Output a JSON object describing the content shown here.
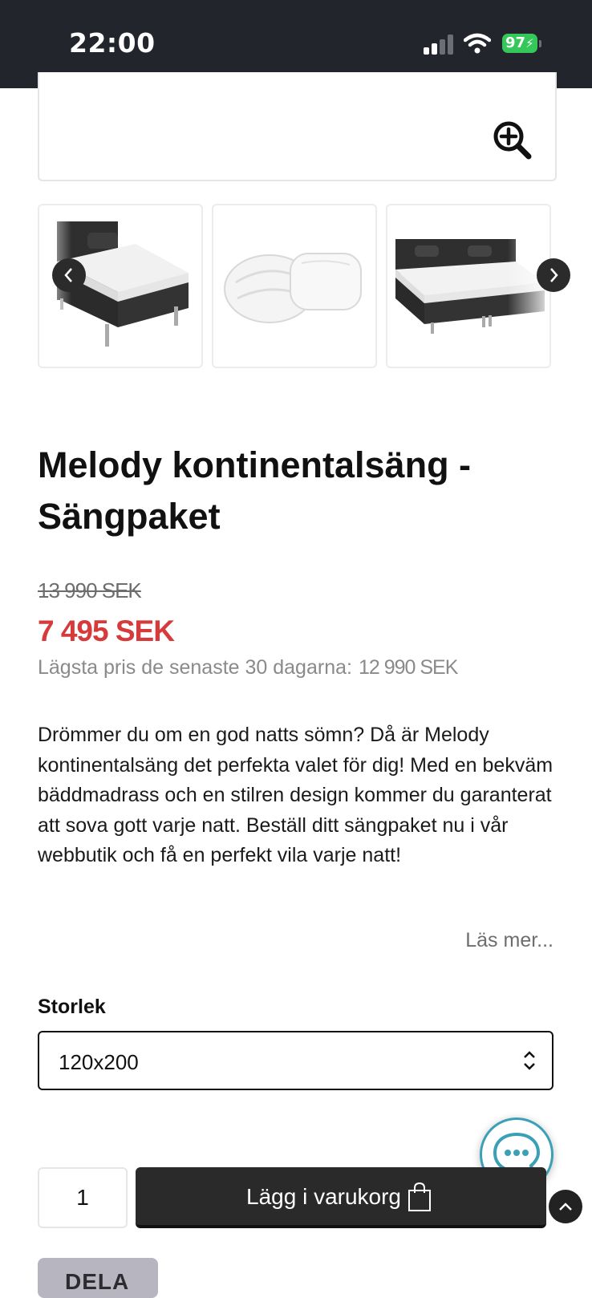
{
  "status_bar": {
    "time": "22:00",
    "battery": "97",
    "icons": [
      "cellular-signal-icon",
      "wifi-icon",
      "battery-charging-icon"
    ]
  },
  "gallery": {
    "zoom_icon": "zoom-in-icon",
    "thumbnails": [
      {
        "alt": "single-bed-image"
      },
      {
        "alt": "duvet-and-pillow-image"
      },
      {
        "alt": "double-bed-image"
      }
    ],
    "prev_icon": "chevron-left-icon",
    "next_icon": "chevron-right-icon"
  },
  "product": {
    "title": "Melody kontinentalsäng - Sängpaket",
    "old_price": "13 990 SEK",
    "price": "7 495 SEK",
    "lowest_price_label": "Lägsta pris de senaste 30 dagarna:",
    "lowest_price_value": "12 990 SEK",
    "description": "Drömmer du om en god natts sömn? Då är Melody kontinentalsäng det perfekta valet för dig! Med en bekväm bäddmadrass och en stilren design kommer du garanterat att sova gott varje natt. Beställ ditt sängpaket nu i vår webbutik och få en perfekt vila varje natt!",
    "read_more": "Läs mer..."
  },
  "options": {
    "size_label": "Storlek",
    "size_value": "120x200"
  },
  "purchase": {
    "quantity": "1",
    "add_to_cart": "Lägg i varukorg",
    "share": "DELA"
  },
  "colors": {
    "status_bar_bg": "#23252c",
    "sale_price": "#d63a3a",
    "button_dark": "#2a2a2a",
    "chat_accent": "#3aa0b6",
    "battery_green": "#34c759"
  }
}
